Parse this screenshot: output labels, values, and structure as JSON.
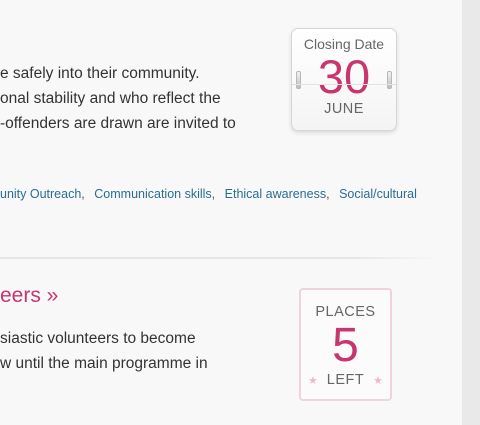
{
  "listing_1": {
    "description_lines": [
      "e safely into their community.",
      "onal stability and who reflect the",
      "-offenders are drawn are invited to"
    ],
    "skills": [
      "unity Outreach",
      "Communication skills",
      "Ethical awareness",
      "Social/cultural"
    ],
    "closing_date": {
      "label": "Closing Date",
      "day": "30",
      "month": "JUNE"
    }
  },
  "listing_2": {
    "title": "eers »",
    "description_lines": [
      "siastic volunteers to become",
      "w until the main programme in"
    ],
    "places": {
      "label": "PLACES",
      "count": "5",
      "suffix": "LEFT"
    }
  },
  "colors": {
    "accent": "#c7366f",
    "link": "#2a6d93",
    "text": "#333333"
  }
}
